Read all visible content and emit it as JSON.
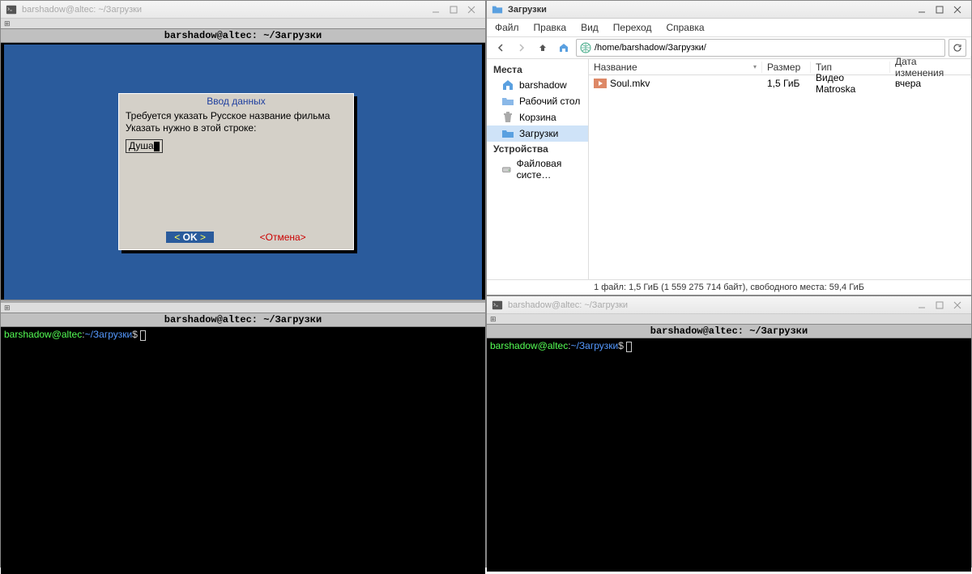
{
  "term1": {
    "title": "barshadow@altec: ~/Загрузки",
    "header": "barshadow@altec: ~/Загрузки"
  },
  "dialog": {
    "title": "Ввод данных",
    "line1": "Требуется указать Русское название фильма",
    "line2": "Указать нужно в этой строке:",
    "input_value": "Душа",
    "ok_l": "<",
    "ok": "OK",
    "ok_r": ">",
    "cancel": "<Отмена>"
  },
  "fm": {
    "title": "Загрузки",
    "menu": {
      "file": "Файл",
      "edit": "Правка",
      "view": "Вид",
      "go": "Переход",
      "help": "Справка"
    },
    "path": "/home/barshadow/Загрузки/",
    "sb_places": "Места",
    "sb": {
      "home": "barshadow",
      "desktop": "Рабочий стол",
      "trash": "Корзина",
      "downloads": "Загрузки"
    },
    "sb_devices": "Устройства",
    "sb_fs": "Файловая систе…",
    "cols": {
      "name": "Название",
      "size": "Размер",
      "type": "Тип",
      "date": "Дата изменения"
    },
    "file": {
      "name": "Soul.mkv",
      "size": "1,5 ГиБ",
      "type": "Видео Matroska",
      "date": "вчера"
    },
    "status": "1 файл: 1,5 ГиБ (1 559 275 714 байт), свободного места: 59,4 ГиБ"
  },
  "term2": {
    "title": "barshadow@altec: ~/Загрузки",
    "header": "barshadow@altec: ~/Загрузки",
    "prompt_user": "barshadow@altec",
    "prompt_sep": ":",
    "prompt_path": "~/Загрузки",
    "prompt_end": "$ "
  },
  "term3": {
    "title": "barshadow@altec: ~/Загрузки",
    "header": "barshadow@altec: ~/Загрузки",
    "prompt_user": "barshadow@altec",
    "prompt_sep": ":",
    "prompt_path": "~/Загрузки",
    "prompt_end": "$ "
  }
}
